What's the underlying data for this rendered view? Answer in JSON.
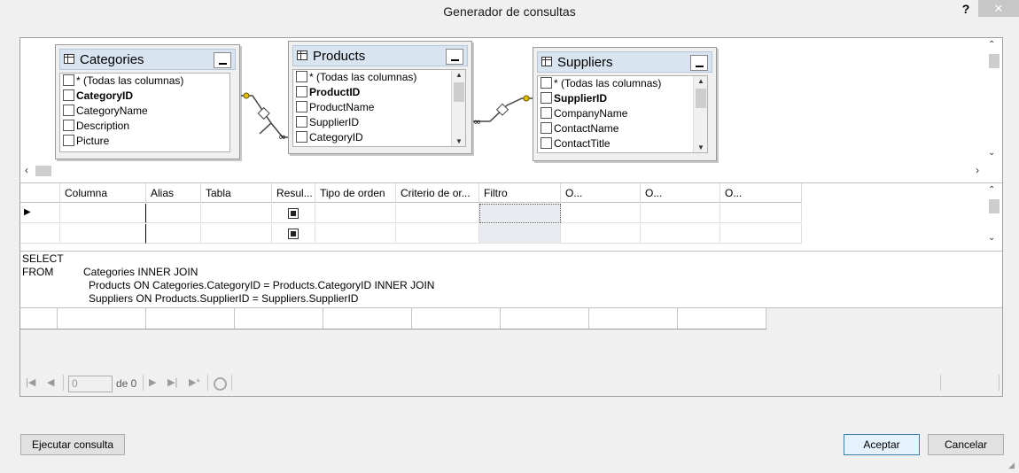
{
  "window": {
    "title": "Generador de consultas",
    "help_label": "?",
    "close_label": "✕"
  },
  "diagram": {
    "tables": [
      {
        "name": "Categories",
        "columns": [
          "* (Todas las columnas)",
          "CategoryID",
          "CategoryName",
          "Description",
          "Picture"
        ],
        "key_column": "CategoryID"
      },
      {
        "name": "Products",
        "columns": [
          "* (Todas las columnas)",
          "ProductID",
          "ProductName",
          "SupplierID",
          "CategoryID"
        ],
        "key_column": "ProductID"
      },
      {
        "name": "Suppliers",
        "columns": [
          "* (Todas las columnas)",
          "SupplierID",
          "CompanyName",
          "ContactName",
          "ContactTitle"
        ],
        "key_column": "SupplierID"
      }
    ]
  },
  "grid": {
    "columns": [
      "Columna",
      "Alias",
      "Tabla",
      "Resul...",
      "Tipo de orden",
      "Criterio de or...",
      "Filtro",
      "O...",
      "O...",
      "O..."
    ],
    "rows": [
      {
        "output_checked": true,
        "current": true
      },
      {
        "output_checked": true,
        "current": false
      }
    ]
  },
  "sql": {
    "lines": [
      {
        "keyword": "SELECT",
        "text": ""
      },
      {
        "keyword": "FROM",
        "text": "Categories INNER JOIN"
      },
      {
        "keyword": "",
        "text": "Products ON Categories.CategoryID = Products.CategoryID INNER JOIN"
      },
      {
        "keyword": "",
        "text": "Suppliers ON Products.SupplierID = Suppliers.SupplierID"
      }
    ]
  },
  "results": {
    "record_value": "0",
    "record_of_label": "de 0"
  },
  "buttons": {
    "execute": "Ejecutar consulta",
    "accept": "Aceptar",
    "cancel": "Cancelar"
  },
  "icons": [
    "table-icon",
    "minimize-icon",
    "key-icon",
    "first-record-icon",
    "previous-record-icon",
    "next-record-icon",
    "last-record-icon",
    "new-record-icon",
    "stop-icon"
  ]
}
